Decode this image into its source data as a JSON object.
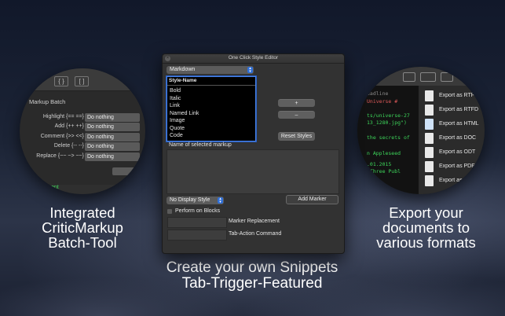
{
  "captions": {
    "left": [
      "Integrated",
      "CriticMarkup",
      "Batch-Tool"
    ],
    "right": [
      "Export your",
      "documents to",
      "various formats"
    ],
    "bottom": [
      "Create your own Snippets",
      "Tab-Trigger-Featured"
    ]
  },
  "left_circle": {
    "title": "Markup Batch",
    "toolbar_icons": [
      "{ }",
      "[ ]"
    ],
    "rows": [
      {
        "label": "Highlight {== ==}",
        "value": "Do nothing"
      },
      {
        "label": "Add {++ ++}",
        "value": "Do nothing"
      },
      {
        "label": "Comment {>> <<}",
        "value": "Do nothing"
      },
      {
        "label": "Delete {-- --}",
        "value": "Do nothing"
      },
      {
        "label": "Replace {~~ ~> ~~}",
        "value": "Do nothing"
      }
    ],
    "footer_text": "ent"
  },
  "right_circle": {
    "code_lines": [
      {
        "text": "eadline",
        "color": "#8a8a8a"
      },
      {
        "text": "Universe #",
        "color": "#e05a5a"
      },
      {
        "text": "ts/universe-27",
        "color": "#3dd55a"
      },
      {
        "text": "13_1280.jpg\")",
        "color": "#3dd55a"
      },
      {
        "text": "the secrets of",
        "color": "#3dd55a"
      },
      {
        "text": "n Appleseed",
        "color": "#3dd55a"
      },
      {
        "text": ".01.2015",
        "color": "#3dd55a"
      },
      {
        "text": "—Three Publ",
        "color": "#3dd55a"
      },
      {
        "text": "Appl",
        "color": "#3dd55a"
      }
    ],
    "export_items": [
      "Export as RTF",
      "Export as RTFD",
      "Export as HTML",
      "Export as DOC",
      "Export as ODT",
      "Export as PDF",
      "Export as"
    ]
  },
  "editor": {
    "title": "One Click Style Editor",
    "format_select": "Markdown",
    "list_header": "Style-Name",
    "styles": [
      "Bold",
      "Italic",
      "Link",
      "Named Link",
      "Image",
      "Quote",
      "Code"
    ],
    "add_button": "+",
    "remove_button": "–",
    "reset_button": "Reset Styles",
    "name_label": "Name of selected markup",
    "display_style_select": "No Display Style",
    "add_marker_button": "Add Marker",
    "perform_on_blocks": "Perform on Blocks",
    "marker_replacement": "Marker Replacement",
    "tab_action": "Tab-Action Command"
  }
}
